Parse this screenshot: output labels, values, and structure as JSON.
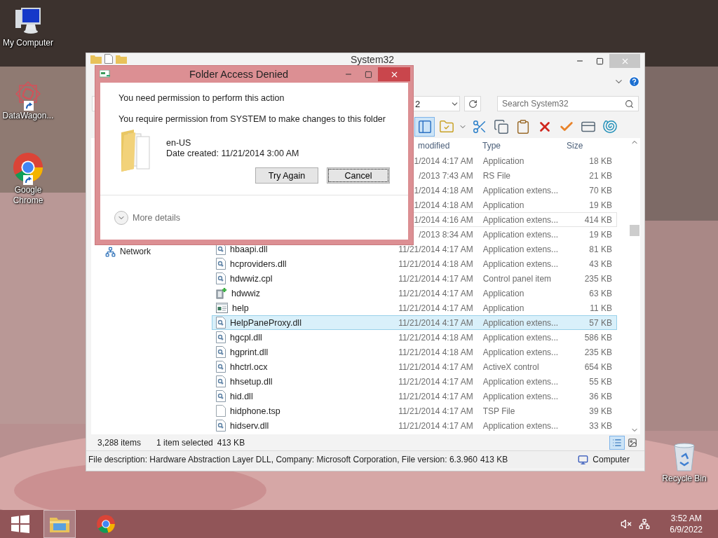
{
  "desktop": {
    "icons": [
      {
        "label": "My Computer",
        "kind": "computer"
      },
      {
        "label": "DataWagon...",
        "kind": "datawagon"
      },
      {
        "label": "Google Chrome",
        "kind": "chrome"
      },
      {
        "label": "Recycle Bin",
        "kind": "recycle"
      }
    ]
  },
  "explorer": {
    "title": "System32",
    "address": "2",
    "search_placeholder": "Search System32",
    "toolbar": [
      {
        "kind": "panes",
        "selected": true
      },
      {
        "kind": "folder-options",
        "selected": false
      },
      {
        "kind": "dropdown",
        "selected": false
      },
      {
        "kind": "cut",
        "selected": false
      },
      {
        "kind": "copy",
        "selected": false
      },
      {
        "kind": "paste",
        "selected": false
      },
      {
        "kind": "delete",
        "selected": false
      },
      {
        "kind": "rename",
        "selected": false
      },
      {
        "kind": "properties",
        "selected": false
      },
      {
        "kind": "shell",
        "selected": false
      }
    ],
    "columns": [
      "modified",
      "Type",
      "Size"
    ],
    "nav": [
      {
        "label": "Network"
      }
    ],
    "rows": [
      {
        "date": "1/2014 4:17 AM",
        "type": "Application",
        "size": "18 KB",
        "selected": false,
        "hovered": false
      },
      {
        "date": "/2013 7:43 AM",
        "type": "RS File",
        "size": "21 KB",
        "selected": false,
        "hovered": false
      },
      {
        "date": "1/2014 4:18 AM",
        "type": "Application extens...",
        "size": "70 KB",
        "selected": false,
        "hovered": false
      },
      {
        "date": "1/2014 4:18 AM",
        "type": "Application",
        "size": "19 KB",
        "selected": false,
        "hovered": false
      },
      {
        "date": "1/2014 4:16 AM",
        "type": "Application extens...",
        "size": "414 KB",
        "selected": false,
        "hovered": true
      },
      {
        "date": "/2013 8:34 AM",
        "type": "Application extens...",
        "size": "19 KB",
        "selected": false,
        "hovered": false
      },
      {
        "name": "hbaapi.dll",
        "kind": "dll",
        "date": "11/21/2014 4:17 AM",
        "type": "Application extens...",
        "size": "81 KB",
        "selected": false,
        "hovered": false
      },
      {
        "name": "hcproviders.dll",
        "kind": "dll",
        "date": "11/21/2014 4:18 AM",
        "type": "Application extens...",
        "size": "43 KB",
        "selected": false,
        "hovered": false
      },
      {
        "name": "hdwwiz.cpl",
        "kind": "dll",
        "date": "11/21/2014 4:17 AM",
        "type": "Control panel item",
        "size": "235 KB",
        "selected": false,
        "hovered": false
      },
      {
        "name": "hdwwiz",
        "kind": "app",
        "date": "11/21/2014 4:17 AM",
        "type": "Application",
        "size": "63 KB",
        "selected": false,
        "hovered": false
      },
      {
        "name": "help",
        "kind": "window",
        "date": "11/21/2014 4:17 AM",
        "type": "Application",
        "size": "11 KB",
        "selected": false,
        "hovered": false
      },
      {
        "name": "HelpPaneProxy.dll",
        "kind": "dll",
        "date": "11/21/2014 4:17 AM",
        "type": "Application extens...",
        "size": "57 KB",
        "selected": true,
        "hovered": false
      },
      {
        "name": "hgcpl.dll",
        "kind": "dll",
        "date": "11/21/2014 4:18 AM",
        "type": "Application extens...",
        "size": "586 KB",
        "selected": false,
        "hovered": false
      },
      {
        "name": "hgprint.dll",
        "kind": "dll",
        "date": "11/21/2014 4:18 AM",
        "type": "Application extens...",
        "size": "235 KB",
        "selected": false,
        "hovered": false
      },
      {
        "name": "hhctrl.ocx",
        "kind": "dll",
        "date": "11/21/2014 4:17 AM",
        "type": "ActiveX control",
        "size": "654 KB",
        "selected": false,
        "hovered": false
      },
      {
        "name": "hhsetup.dll",
        "kind": "dll",
        "date": "11/21/2014 4:17 AM",
        "type": "Application extens...",
        "size": "55 KB",
        "selected": false,
        "hovered": false
      },
      {
        "name": "hid.dll",
        "kind": "dll",
        "date": "11/21/2014 4:17 AM",
        "type": "Application extens...",
        "size": "36 KB",
        "selected": false,
        "hovered": false
      },
      {
        "name": "hidphone.tsp",
        "kind": "blank",
        "date": "11/21/2014 4:17 AM",
        "type": "TSP File",
        "size": "39 KB",
        "selected": false,
        "hovered": false
      },
      {
        "name": "hidserv.dll",
        "kind": "dll",
        "date": "11/21/2014 4:17 AM",
        "type": "Application extens...",
        "size": "33 KB",
        "selected": false,
        "hovered": false
      }
    ],
    "status": {
      "count": "3,288 items",
      "selection": "1 item selected",
      "size": "413 KB"
    },
    "views": [
      {
        "kind": "details",
        "selected": true
      },
      {
        "kind": "thumbnails",
        "selected": false
      }
    ],
    "details": {
      "description": "File description: Hardware Abstraction Layer DLL, Company: Microsoft Corporation, File version: 6.3.960",
      "size": "413 KB",
      "location": "Computer"
    }
  },
  "dialog": {
    "title": "Folder Access Denied",
    "message": "You need permission to perform this action",
    "detail": "You require permission from SYSTEM to make changes to this folder",
    "item_name": "en-US",
    "item_date": "Date created: 11/21/2014 3:00 AM",
    "buttons": [
      {
        "label": "Try Again",
        "focused": false
      },
      {
        "label": "Cancel",
        "focused": true
      }
    ],
    "more": "More details"
  },
  "taskbar": {
    "apps": [
      {
        "kind": "explorer",
        "active": true
      },
      {
        "kind": "chrome",
        "active": false
      }
    ],
    "time": "3:52 AM",
    "date": "6/9/2022"
  }
}
